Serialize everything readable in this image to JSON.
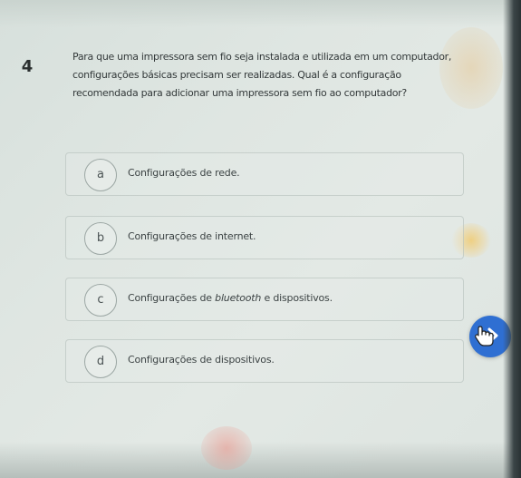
{
  "question": {
    "number": "4",
    "text": "Para que uma impressora sem fio seja instalada e utilizada em um computador, configurações básicas precisam ser realizadas. Qual é a configuração recomendada para adicionar uma impressora sem fio ao computador?"
  },
  "options": [
    {
      "letter": "a",
      "label": "Configurações de rede."
    },
    {
      "letter": "b",
      "label": "Configurações de internet."
    },
    {
      "letter": "c",
      "label_before": "Configurações de ",
      "label_italic": "bluetooth",
      "label_after": " e dispositivos."
    },
    {
      "letter": "d",
      "label": "Configurações de dispositivos."
    }
  ],
  "colors": {
    "accent": "#2f6fd2",
    "background": "#dfe6e2",
    "text": "#33393a"
  },
  "icons": {
    "next": "chevron-right-icon",
    "cursor": "hand-pointer-icon"
  }
}
